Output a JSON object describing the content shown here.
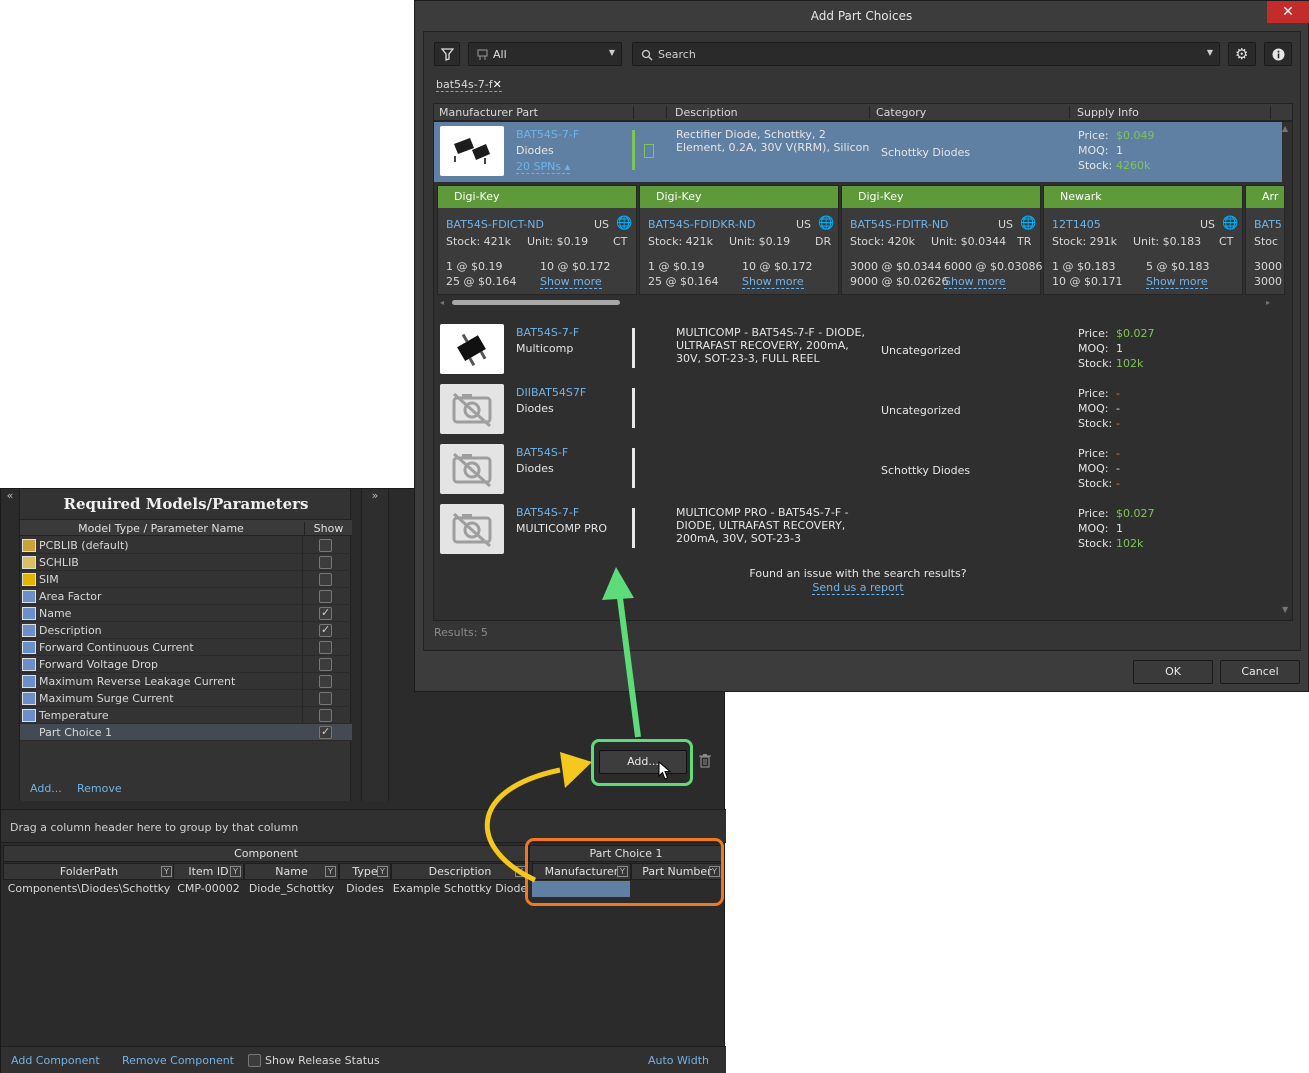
{
  "editor": {
    "req_panel": {
      "title": "Required Models/Parameters",
      "col_name": "Model Type / Parameter Name",
      "col_show": "Show",
      "rows": [
        {
          "label": "PCBLIB (default)",
          "icon": "pcblib-icon",
          "checked": false
        },
        {
          "label": "SCHLIB",
          "icon": "schlib-icon",
          "checked": false
        },
        {
          "label": "SIM",
          "icon": "sim-icon",
          "checked": false
        },
        {
          "label": "Area Factor",
          "icon": "parameter-icon",
          "checked": false
        },
        {
          "label": "Name",
          "icon": "parameter-icon",
          "checked": true
        },
        {
          "label": "Description",
          "icon": "parameter-icon",
          "checked": true
        },
        {
          "label": "Forward Continuous Current",
          "icon": "parameter-icon",
          "checked": false
        },
        {
          "label": "Forward Voltage Drop",
          "icon": "parameter-icon",
          "checked": false
        },
        {
          "label": "Maximum Reverse Leakage Current",
          "icon": "parameter-icon",
          "checked": false
        },
        {
          "label": "Maximum Surge Current",
          "icon": "parameter-icon",
          "checked": false
        },
        {
          "label": "Temperature",
          "icon": "parameter-icon",
          "checked": false
        },
        {
          "label": "Part Choice 1",
          "icon": "",
          "checked": true
        }
      ],
      "add_label": "Add...",
      "remove_label": "Remove",
      "collapse_left": "«",
      "collapse_right": "»"
    },
    "add_button_label": "Add...",
    "group_hint": "Drag a column header here to group by that column",
    "grid": {
      "group_component": "Component",
      "group_part_choice": "Part Choice 1",
      "columns": [
        "FolderPath",
        "Item ID",
        "Name",
        "Type",
        "Description",
        "Manufacturer",
        "Part Number"
      ],
      "rows": [
        [
          "Components\\Diodes\\Schottky",
          "CMP-00002",
          "Diode_Schottky",
          "Diodes",
          "Example Schottky Diode",
          "",
          ""
        ]
      ]
    },
    "bottom": {
      "add_component": "Add Component",
      "remove_component": "Remove Component",
      "show_release_status": "Show Release Status",
      "auto_width": "Auto Width"
    }
  },
  "dialog": {
    "title": "Add Part Choices",
    "close": "✕",
    "category_value": "All",
    "search_placeholder": "Search",
    "chip": "bat54s-7-f",
    "chip_close": "✕",
    "columns": [
      "Manufacturer Part",
      "Description",
      "Category",
      "Supply Info"
    ],
    "info_keys": [
      "Price:",
      "MOQ:",
      "Stock:"
    ],
    "results": [
      {
        "part": "BAT54S-7-F",
        "mfr": "Diodes",
        "spns": "20 SPNs ▴",
        "desc": "Rectifier Diode, Schottky, 2 Element, 0.2A, 30V V(RRM), Silicon",
        "category": "Schottky Diodes",
        "price": "$0.049",
        "moq": "1",
        "stock": "4260k"
      },
      {
        "part": "BAT54S-7-F",
        "mfr": "Multicomp",
        "spns": "",
        "desc": "MULTICOMP - BAT54S-7-F - DIODE, ULTRAFAST RECOVERY, 200mA, 30V, SOT-23-3, FULL REEL",
        "category": "Uncategorized",
        "price": "$0.027",
        "moq": "1",
        "stock": "102k"
      },
      {
        "part": "DIIBAT54S7F",
        "mfr": "Diodes",
        "spns": "",
        "desc": "",
        "category": "Uncategorized",
        "price": "-",
        "moq": "-",
        "stock": "-"
      },
      {
        "part": "BAT54S-F",
        "mfr": "Diodes",
        "spns": "",
        "desc": "",
        "category": "Schottky Diodes",
        "price": "-",
        "moq": "-",
        "stock": "-"
      },
      {
        "part": "BAT54S-7-F",
        "mfr": "MULTICOMP PRO",
        "spns": "",
        "desc": "MULTICOMP PRO - BAT54S-7-F - DIODE, ULTRAFAST RECOVERY, 200mA, 30V, SOT-23-3",
        "category": "",
        "price": "$0.027",
        "moq": "1",
        "stock": "102k"
      }
    ],
    "suppliers": [
      {
        "name": "Digi-Key",
        "spn": "BAT54S-FDICT-ND",
        "region": "US",
        "stock": "Stock: 421k",
        "unit": "Unit: $0.19",
        "pkg": "CT",
        "b1": "1 @ $0.19",
        "b2": "10 @ $0.172",
        "b3": "25 @ $0.164",
        "more": "Show more"
      },
      {
        "name": "Digi-Key",
        "spn": "BAT54S-FDIDKR-ND",
        "region": "US",
        "stock": "Stock: 421k",
        "unit": "Unit: $0.19",
        "pkg": "DR",
        "b1": "1 @ $0.19",
        "b2": "10 @ $0.172",
        "b3": "25 @ $0.164",
        "more": "Show more"
      },
      {
        "name": "Digi-Key",
        "spn": "BAT54S-FDITR-ND",
        "region": "US",
        "stock": "Stock: 420k",
        "unit": "Unit: $0.0344",
        "pkg": "TR",
        "b1": "3000 @ $0.0344",
        "b2": "6000 @ $0.03086",
        "b3": "9000 @ $0.02626",
        "more": "Show more"
      },
      {
        "name": "Newark",
        "spn": "12T1405",
        "region": "US",
        "stock": "Stock: 291k",
        "unit": "Unit: $0.183",
        "pkg": "CT",
        "b1": "1 @ $0.183",
        "b2": "5 @ $0.183",
        "b3": "10 @ $0.171",
        "more": "Show more"
      },
      {
        "name": "Arr",
        "spn": "BAT5",
        "region": "",
        "stock": "Stoc",
        "unit": "",
        "pkg": "",
        "b1": "3000",
        "b2": "",
        "b3": "3000",
        "more": ""
      }
    ],
    "issue_text": "Found an issue with the search results?",
    "issue_link": "Send us a report",
    "results_count": "Results: 5",
    "ok": "OK",
    "cancel": "Cancel"
  },
  "colors": {
    "accent_link": "#6fb3ea",
    "supplier_header": "#5e9a3a",
    "selected_row": "#5f7fa3",
    "highlight_green": "#5fdc7a",
    "highlight_orange": "#f07820",
    "arrow_yellow": "#f5c81e"
  }
}
